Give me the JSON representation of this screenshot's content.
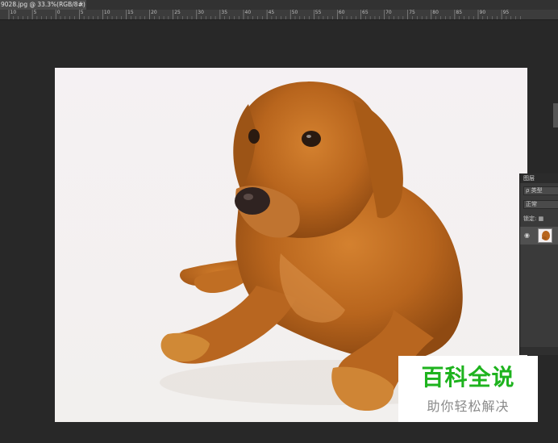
{
  "document_tab": {
    "title": "9028.jpg @ 33.3%(RGB/8#)",
    "close_glyph": "×"
  },
  "ruler": {
    "labels": [
      "10",
      "5",
      "0",
      "5",
      "10",
      "15",
      "20",
      "25",
      "30",
      "35",
      "40",
      "45",
      "50",
      "55",
      "60",
      "65",
      "70",
      "75",
      "80",
      "85",
      "90",
      "95"
    ]
  },
  "canvas": {
    "subject": "golden retriever photo",
    "background_color": "#f4f0f2"
  },
  "layers_panel": {
    "title": "图层",
    "filter_label": "ρ 类型",
    "blend_mode": "正常",
    "lock_label": "锁定:",
    "layer_visibility_icon": "eye-icon"
  },
  "watermark": {
    "title": "百科全说",
    "subtitle": "助你轻松解决",
    "title_color": "#1eb31e"
  }
}
